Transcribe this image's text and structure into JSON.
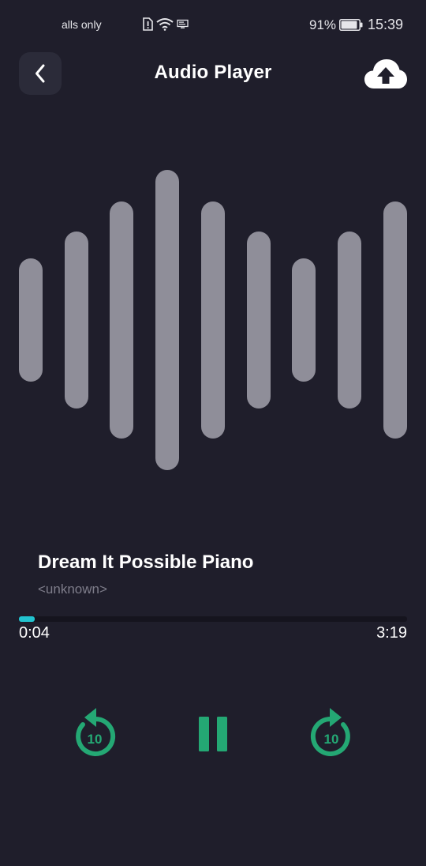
{
  "status_bar": {
    "carrier": "alls only",
    "battery_percent": "91%",
    "battery_level": 0.91,
    "time": "15:39"
  },
  "header": {
    "title": "Audio Player",
    "back_icon": "chevron-left-icon",
    "upload_icon": "cloud-upload-icon"
  },
  "waveform": {
    "levels": [
      0.41,
      0.59,
      0.79,
      1.0,
      0.79,
      0.59,
      0.41,
      0.59,
      0.79
    ],
    "color": "#8f8e99"
  },
  "track": {
    "title": "Dream It Possible Piano",
    "artist": "<unknown>"
  },
  "progress": {
    "elapsed": "0:04",
    "total": "3:19",
    "fraction": 0.02,
    "color": "#22c3cf"
  },
  "controls": {
    "rewind_seconds": "10",
    "forward_seconds": "10",
    "accent": "#24a874"
  }
}
